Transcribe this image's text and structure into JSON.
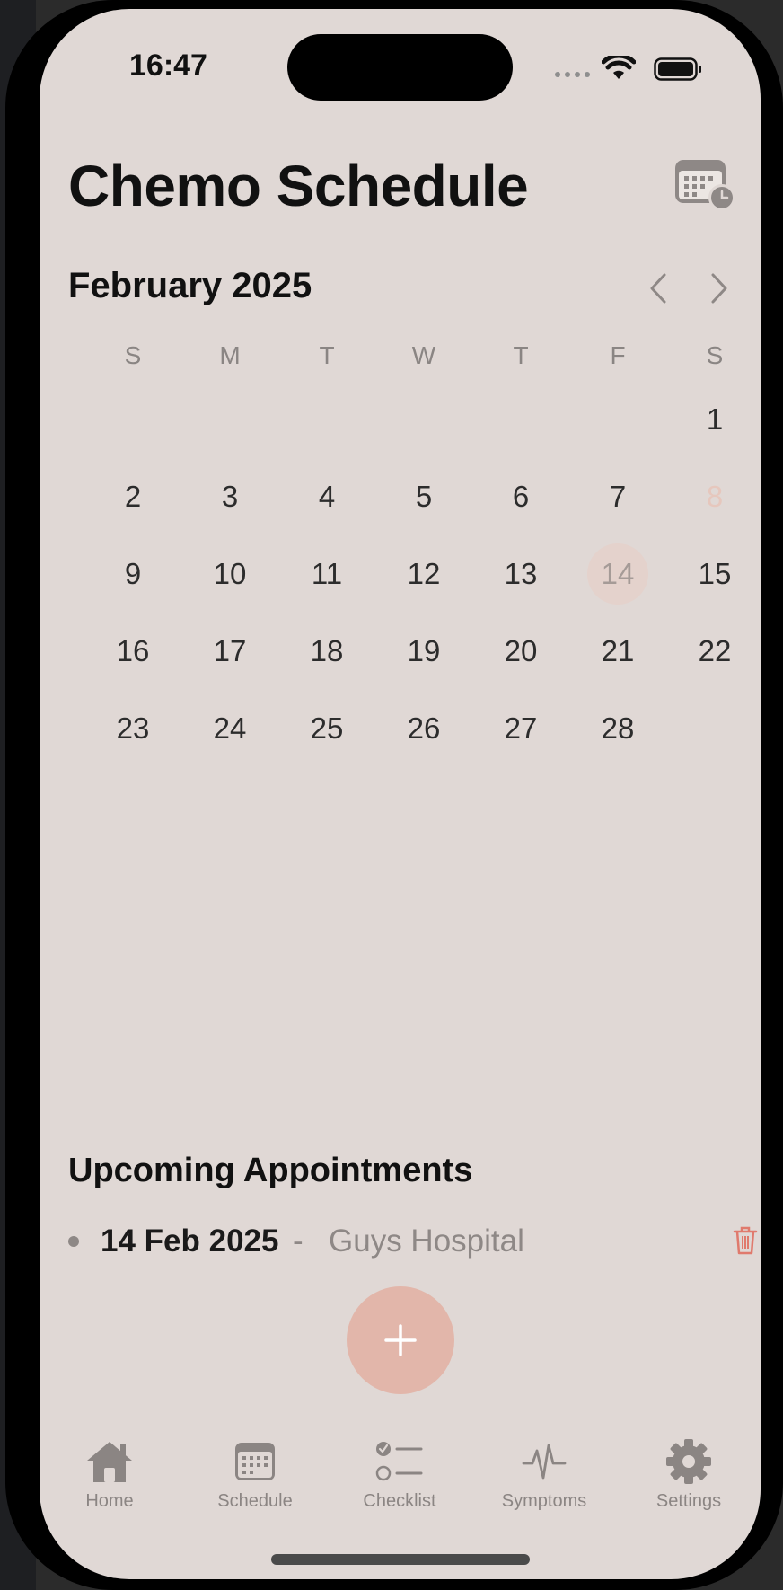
{
  "status": {
    "time": "16:47"
  },
  "header": {
    "title": "Chemo Schedule",
    "calendar_icon": "calendar-clock-icon"
  },
  "calendar": {
    "month_label": "February 2025",
    "weekdays": [
      "S",
      "M",
      "T",
      "W",
      "T",
      "F",
      "S"
    ],
    "days": [
      "1",
      "2",
      "3",
      "4",
      "5",
      "6",
      "7",
      "8",
      "9",
      "10",
      "11",
      "12",
      "13",
      "14",
      "15",
      "16",
      "17",
      "18",
      "19",
      "20",
      "21",
      "22",
      "23",
      "24",
      "25",
      "26",
      "27",
      "28"
    ],
    "selected_day": "14",
    "muted_day": "8",
    "colors": {
      "selected_bg": "#e4d2cc",
      "muted": "#e6c7bd"
    }
  },
  "upcoming": {
    "title": "Upcoming Appointments",
    "items": [
      {
        "date": "14 Feb 2025",
        "separator": "-",
        "place": "Guys Hospital"
      }
    ]
  },
  "fab": {
    "icon": "plus-icon",
    "color": "#e2b6aa"
  },
  "tabbar": {
    "items": [
      {
        "label": "Home",
        "icon": "home-icon"
      },
      {
        "label": "Schedule",
        "icon": "calendar-icon"
      },
      {
        "label": "Checklist",
        "icon": "checklist-icon"
      },
      {
        "label": "Symptoms",
        "icon": "waveform-icon"
      },
      {
        "label": "Settings",
        "icon": "gear-icon"
      }
    ]
  },
  "colors": {
    "background": "#e0d8d5",
    "accent": "#e2b6aa",
    "danger": "#e07a6d"
  }
}
